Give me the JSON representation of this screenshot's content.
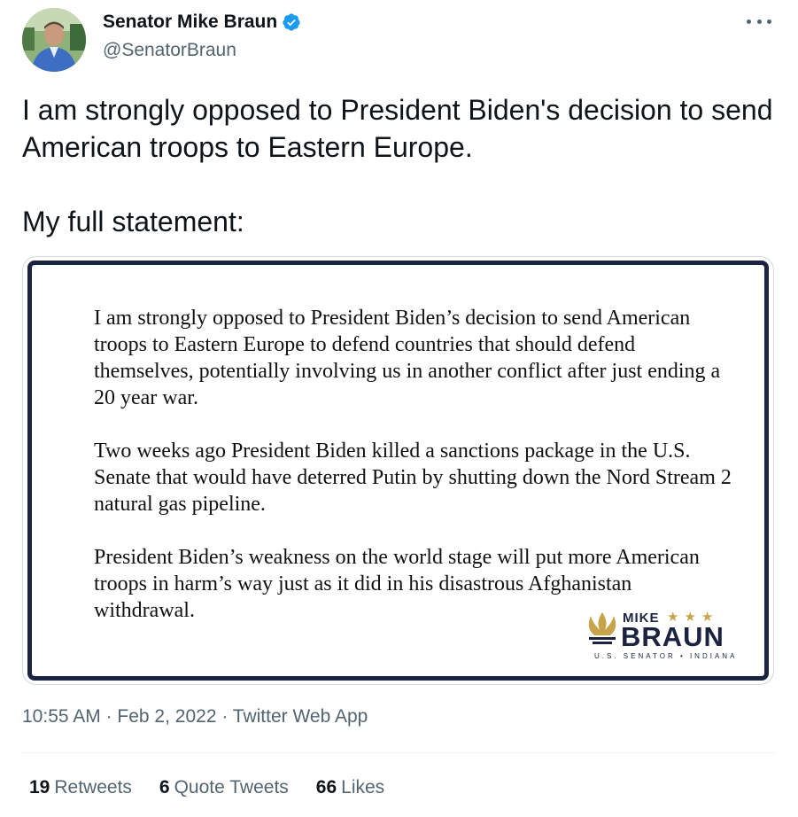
{
  "author": {
    "display_name": "Senator Mike Braun",
    "handle": "@SenatorBraun",
    "avatar_icon": "profile-photo",
    "verified_icon": "verified-badge-icon",
    "verified_color": "#1d9bf0"
  },
  "more_icon": "more-options-icon",
  "tweet": {
    "text": "I am strongly opposed to President Biden's decision to send American troops to Eastern Europe.\n\nMy full statement:"
  },
  "media": {
    "paragraphs": [
      "I am strongly opposed to President Biden’s decision to send American troops to Eastern Europe to defend countries that should defend themselves, potentially involving us in another conflict after just ending a 20 year war.",
      "Two weeks ago President Biden killed a sanctions package in the U.S. Senate that would have deterred Putin by shutting down the Nord Stream 2 natural gas pipeline.",
      "President Biden’s weakness on the world stage will put more American troops in harm’s way just as it did in his disastrous Afghanistan withdrawal."
    ],
    "logo": {
      "first": "MIKE",
      "stars": "★★★",
      "last": "BRAUN",
      "subtitle": "U.S. SENATOR • INDIANA",
      "navy": "#1c2340",
      "gold": "#c9a34a"
    }
  },
  "meta": {
    "time": "10:55 AM",
    "sep1": " · ",
    "date": "Feb 2, 2022",
    "sep2": " · ",
    "source": "Twitter Web App"
  },
  "stats": {
    "retweets_count": "19",
    "retweets_label": "Retweets",
    "quotes_count": "6",
    "quotes_label": "Quote Tweets",
    "likes_count": "66",
    "likes_label": "Likes"
  }
}
